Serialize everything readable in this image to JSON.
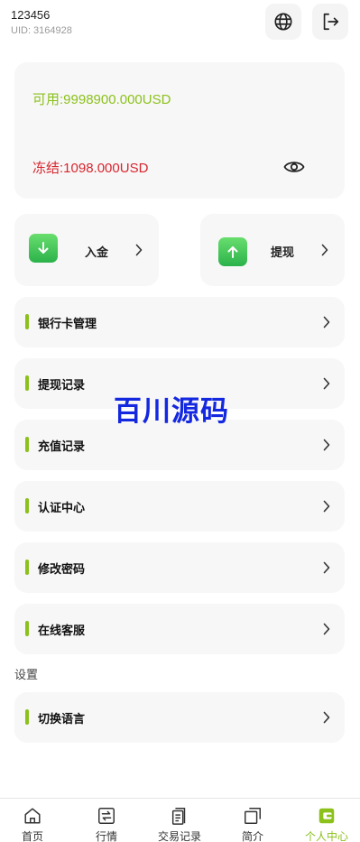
{
  "header": {
    "username": "123456",
    "uid": "UID: 3164928",
    "globe_icon": "globe-icon",
    "logout_icon": "logout-icon"
  },
  "balance": {
    "available": "可用:9998900.000USD",
    "frozen": "冻结:1098.000USD",
    "available_color": "#8cc11c",
    "frozen_color": "#d8262f",
    "eye_icon": "eye-icon"
  },
  "actions": {
    "deposit_label": "入金",
    "withdraw_label": "提现"
  },
  "menu": [
    {
      "label": "银行卡管理"
    },
    {
      "label": "提现记录"
    },
    {
      "label": "充值记录"
    },
    {
      "label": "认证中心"
    },
    {
      "label": "修改密码"
    },
    {
      "label": "在线客服"
    }
  ],
  "settings": {
    "title": "设置",
    "items": [
      {
        "label": "切换语言"
      }
    ]
  },
  "watermark": "百川源码",
  "tabs": [
    {
      "label": "首页",
      "icon": "home-icon",
      "active": false
    },
    {
      "label": "行情",
      "icon": "exchange-icon",
      "active": false
    },
    {
      "label": "交易记录",
      "icon": "records-icon",
      "active": false
    },
    {
      "label": "简介",
      "icon": "copy-icon",
      "active": false
    },
    {
      "label": "个人中心",
      "icon": "wallet-icon",
      "active": true
    }
  ],
  "accent_color": "#8cc11c"
}
